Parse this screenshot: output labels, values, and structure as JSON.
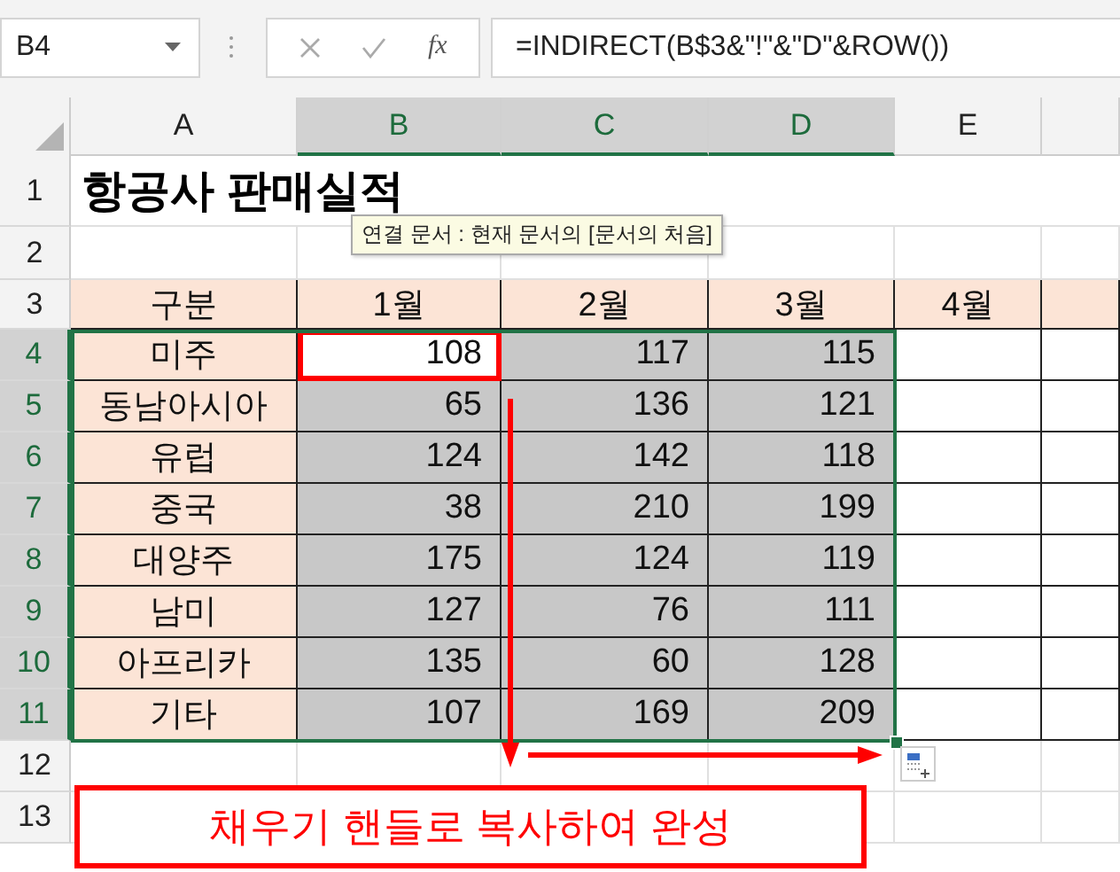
{
  "name_box": "B4",
  "fx_label": "fx",
  "formula": "=INDIRECT(B$3&\"!\"&\"D\"&ROW())",
  "columns": [
    {
      "label": "A",
      "selected": false
    },
    {
      "label": "B",
      "selected": true
    },
    {
      "label": "C",
      "selected": true
    },
    {
      "label": "D",
      "selected": true
    },
    {
      "label": "E",
      "selected": false
    },
    {
      "selected": false
    }
  ],
  "rows": [
    {
      "number": "1",
      "kind": "title",
      "selected": false,
      "cells": [
        "항공사 판매실적"
      ]
    },
    {
      "number": "2",
      "kind": "blank",
      "selected": false,
      "cells": []
    },
    {
      "number": "3",
      "kind": "header",
      "selected": false,
      "cells": [
        "구분",
        "1월",
        "2월",
        "3월",
        "4월"
      ]
    },
    {
      "number": "4",
      "kind": "data",
      "selected": true,
      "cells": [
        {
          "text": "미주",
          "selected": false,
          "active": false
        },
        {
          "text": "108",
          "selected": false,
          "active": true
        },
        {
          "text": "117",
          "selected": true,
          "active": false
        },
        {
          "text": "115",
          "selected": true,
          "active": false
        }
      ]
    },
    {
      "number": "5",
      "kind": "data",
      "selected": true,
      "cells": [
        {
          "text": "동남아시아",
          "selected": false,
          "active": false
        },
        {
          "text": "65",
          "selected": true,
          "active": false
        },
        {
          "text": "136",
          "selected": true,
          "active": false
        },
        {
          "text": "121",
          "selected": true,
          "active": false
        }
      ]
    },
    {
      "number": "6",
      "kind": "data",
      "selected": true,
      "cells": [
        {
          "text": "유럽",
          "selected": false,
          "active": false
        },
        {
          "text": "124",
          "selected": true,
          "active": false
        },
        {
          "text": "142",
          "selected": true,
          "active": false
        },
        {
          "text": "118",
          "selected": true,
          "active": false
        }
      ]
    },
    {
      "number": "7",
      "kind": "data",
      "selected": true,
      "cells": [
        {
          "text": "중국",
          "selected": false,
          "active": false
        },
        {
          "text": "38",
          "selected": true,
          "active": false
        },
        {
          "text": "210",
          "selected": true,
          "active": false
        },
        {
          "text": "199",
          "selected": true,
          "active": false
        }
      ]
    },
    {
      "number": "8",
      "kind": "data",
      "selected": true,
      "cells": [
        {
          "text": "대양주",
          "selected": false,
          "active": false
        },
        {
          "text": "175",
          "selected": true,
          "active": false
        },
        {
          "text": "124",
          "selected": true,
          "active": false
        },
        {
          "text": "119",
          "selected": true,
          "active": false
        }
      ]
    },
    {
      "number": "9",
      "kind": "data",
      "selected": true,
      "cells": [
        {
          "text": "남미",
          "selected": false,
          "active": false
        },
        {
          "text": "127",
          "selected": true,
          "active": false
        },
        {
          "text": "76",
          "selected": true,
          "active": false
        },
        {
          "text": "111",
          "selected": true,
          "active": false
        }
      ]
    },
    {
      "number": "10",
      "kind": "data",
      "selected": true,
      "cells": [
        {
          "text": "아프리카",
          "selected": false,
          "active": false
        },
        {
          "text": "135",
          "selected": true,
          "active": false
        },
        {
          "text": "60",
          "selected": true,
          "active": false
        },
        {
          "text": "128",
          "selected": true,
          "active": false
        }
      ]
    },
    {
      "number": "11",
      "kind": "data",
      "selected": true,
      "cells": [
        {
          "text": "기타",
          "selected": false,
          "active": false
        },
        {
          "text": "107",
          "selected": true,
          "active": false
        },
        {
          "text": "169",
          "selected": true,
          "active": false
        },
        {
          "text": "209",
          "selected": true,
          "active": false
        }
      ]
    },
    {
      "number": "12",
      "kind": "blank",
      "selected": false,
      "cells": []
    },
    {
      "number": "13",
      "kind": "blank",
      "selected": false,
      "cells": []
    }
  ],
  "tooltip": "연결 문서 : 현재 문서의 [문서의 처음]",
  "caption": "채우기 핸들로 복사하여 완성"
}
